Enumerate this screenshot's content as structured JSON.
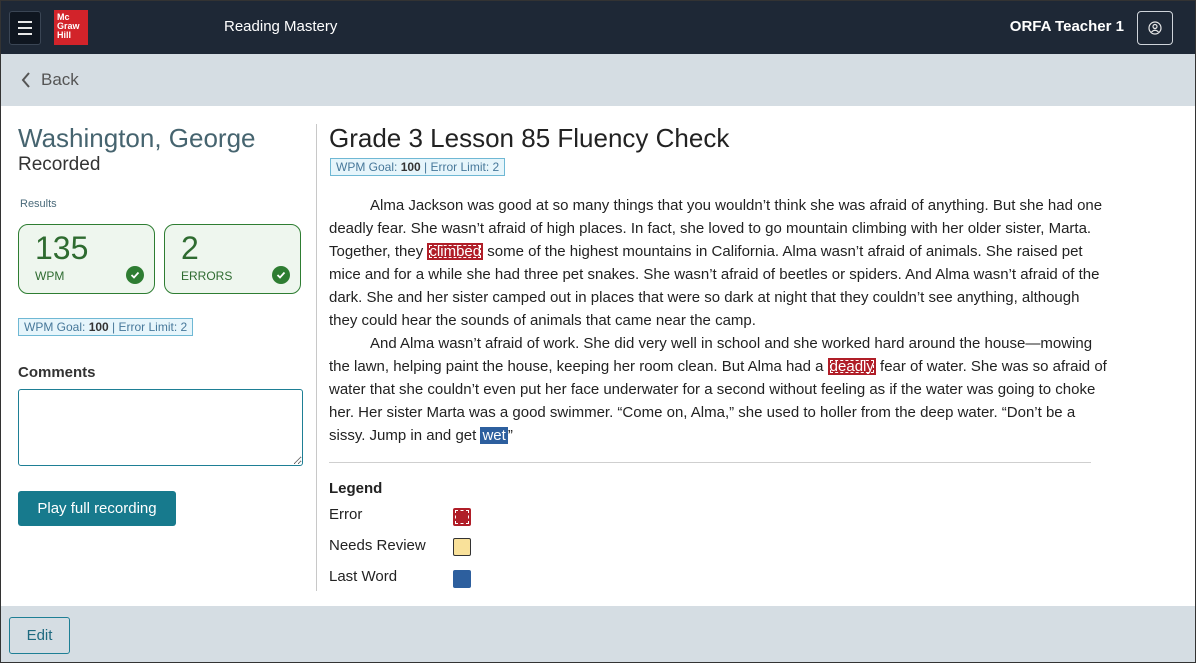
{
  "header": {
    "logo_lines": [
      "Mc",
      "Graw",
      "Hill"
    ],
    "app_title": "Reading Mastery",
    "user_name": "ORFA Teacher 1"
  },
  "nav": {
    "back_label": "Back"
  },
  "student": {
    "name": "Washington, George",
    "status": "Recorded",
    "results_label": "Results",
    "wpm_value": "135",
    "wpm_label": "WPM",
    "errors_value": "2",
    "errors_label": "ERRORS",
    "goal_prefix": "WPM Goal: ",
    "goal_value": "100",
    "goal_sep": " | Error Limit: ",
    "error_limit": "2",
    "comments_label": "Comments",
    "comments_value": "",
    "play_label": "Play full recording"
  },
  "lesson": {
    "title": "Grade 3 Lesson 85 Fluency Check",
    "p1_a": "Alma Jackson was good at so many things that you wouldn’t think she was afraid of anything. But she had one deadly fear. She wasn’t afraid of high places. In fact, she loved to go mountain climbing with her older sister, Marta. Together, they ",
    "p1_err": "climbed",
    "p1_b": " some of the highest mountains in California. Alma wasn’t afraid of animals. She raised pet mice and for a while she had three pet snakes. She wasn’t afraid of beetles or spiders. And Alma wasn’t afraid of the dark. She and her sister camped out in places that were so dark at night that they couldn’t see anything, although they could hear the sounds of animals that came near the camp.",
    "p2_a": "And Alma wasn’t afraid of work. She did very well in school and she worked hard around the house—mowing the lawn, helping paint the house, keeping her room clean.  But Alma had a ",
    "p2_err": "deadly",
    "p2_b": " fear of water. She was so afraid of water that she couldn’t even put her face underwater for a second without feeling as if the water was going to choke her. Her sister Marta was a good swimmer. “Come on, Alma,” she used to holler from the deep water. “Don’t be a sissy. Jump in and get ",
    "p2_last": "wet",
    "p2_c": "”"
  },
  "legend": {
    "title": "Legend",
    "items": [
      {
        "label": "Error",
        "color": "#b01e28"
      },
      {
        "label": "Needs Review",
        "color": "#f9e19a"
      },
      {
        "label": "Last Word",
        "color": "#2d5f9e"
      }
    ]
  },
  "footer": {
    "edit_label": "Edit"
  }
}
